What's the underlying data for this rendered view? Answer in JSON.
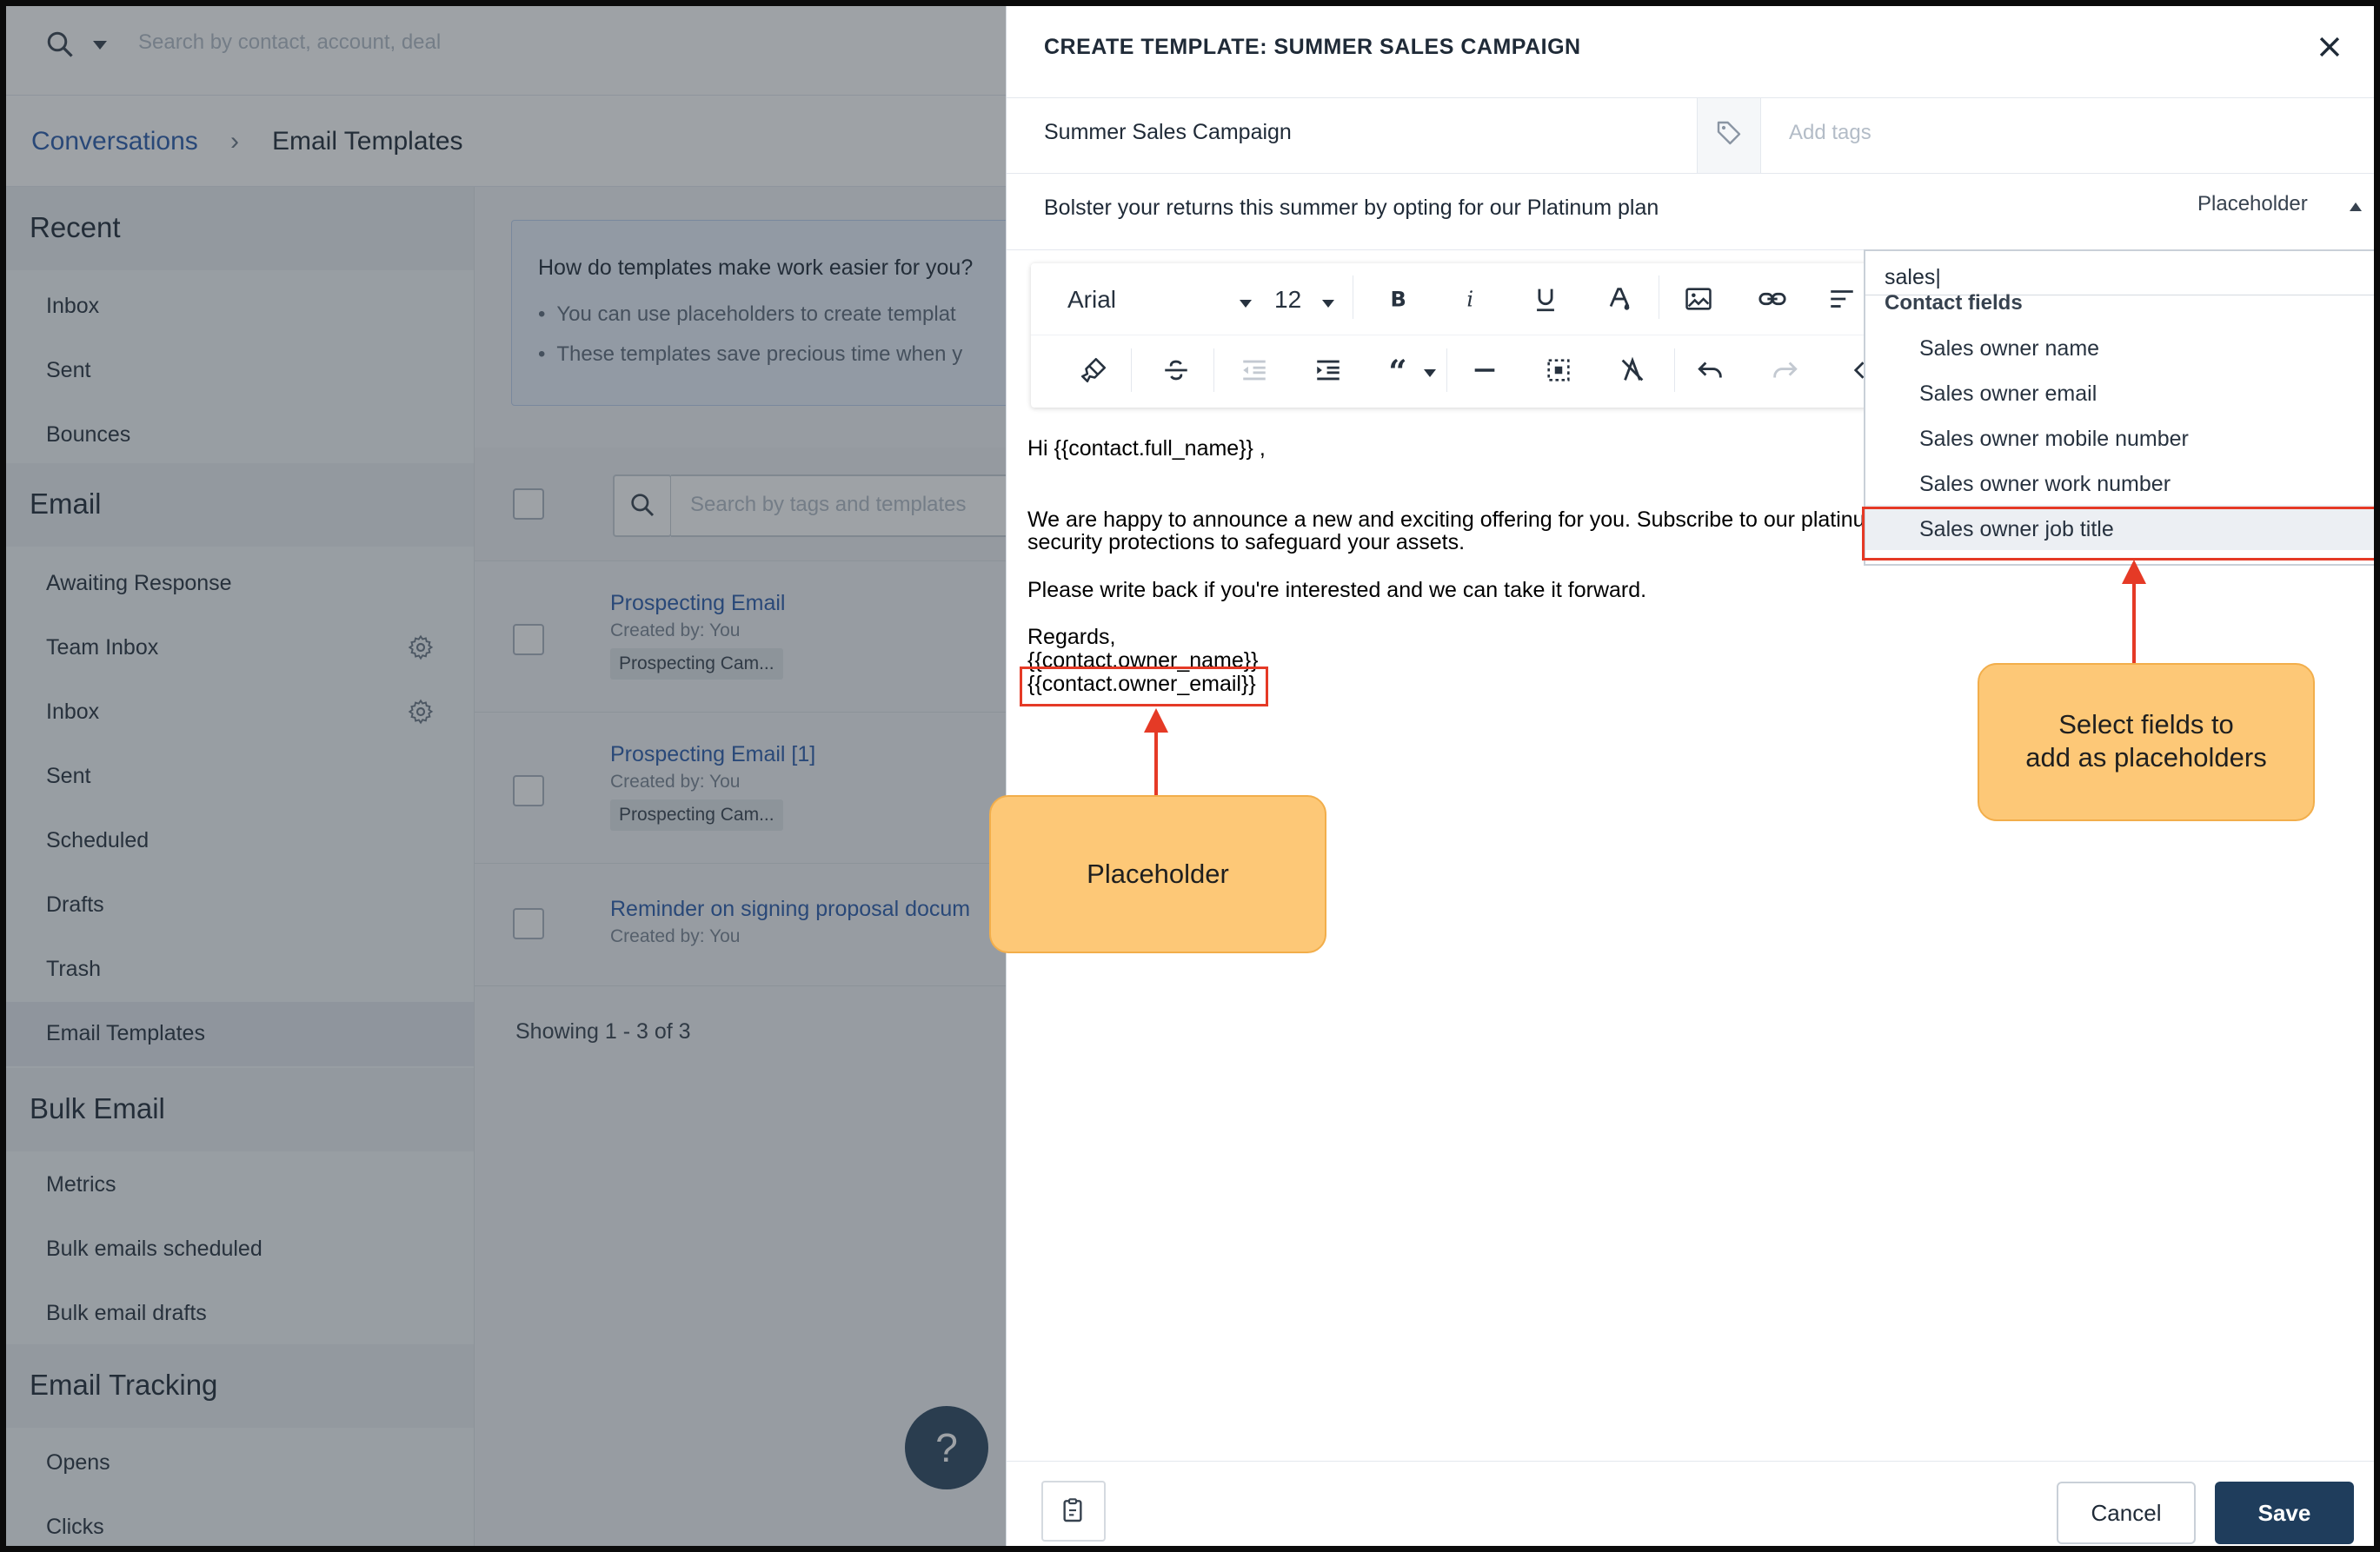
{
  "topbar": {
    "search_placeholder": "Search by contact, account, deal"
  },
  "breadcrumb": {
    "parent": "Conversations",
    "separator": "›",
    "current": "Email Templates"
  },
  "sidebar": {
    "sections": [
      {
        "title": "Recent",
        "items": [
          "Inbox",
          "Sent",
          "Bounces"
        ]
      },
      {
        "title": "Email",
        "items": [
          "Awaiting Response",
          "Team Inbox",
          "Inbox",
          "Sent",
          "Scheduled",
          "Drafts",
          "Trash",
          "Email Templates"
        ]
      },
      {
        "title": "Bulk Email",
        "items": [
          "Metrics",
          "Bulk emails scheduled",
          "Bulk email drafts"
        ]
      },
      {
        "title": "Email Tracking",
        "items": [
          "Opens",
          "Clicks"
        ]
      }
    ],
    "active_item": "Email Templates"
  },
  "info": {
    "title": "How do templates make work easier for you?",
    "bullets": [
      "You can use placeholders to create templat",
      "These templates save precious time when y"
    ]
  },
  "list": {
    "search_placeholder": "Search by tags and templates",
    "rows": [
      {
        "title": "Prospecting Email",
        "created": "Created by: You",
        "tag": "Prospecting Cam..."
      },
      {
        "title": "Prospecting Email [1]",
        "created": "Created by: You",
        "tag": "Prospecting Cam..."
      },
      {
        "title": "Reminder on signing proposal docum",
        "created": "Created by: You"
      }
    ],
    "showing": "Showing 1 - 3 of 3"
  },
  "help": {
    "label": "?"
  },
  "drawer": {
    "title": "CREATE TEMPLATE: SUMMER SALES CAMPAIGN",
    "name": "Summer Sales Campaign",
    "tags_placeholder": "Add tags",
    "subject": "Bolster your returns this summer by opting for our Platinum plan",
    "placeholder_button": "Placeholder",
    "toolbar": {
      "font": "Arial",
      "size": "12"
    },
    "body": {
      "greeting": "Hi {{contact.full_name}} ,",
      "line1": "We are happy to announce a new and exciting offering for you. Subscribe to our platinum",
      "line2": "security protections to safeguard your assets.",
      "line3": "Please write back if you're interested and we can take it forward.",
      "regards": "Regards,",
      "owner_name": "{{contact.owner_name}}",
      "owner_email": "{{contact.owner_email}}"
    },
    "dropdown": {
      "query": "sales|",
      "group": "Contact fields",
      "options": [
        "Sales owner name",
        "Sales owner email",
        "Sales owner mobile number",
        "Sales owner work number",
        "Sales owner job title"
      ],
      "selected": "Sales owner job title"
    },
    "footer": {
      "cancel": "Cancel",
      "save": "Save"
    }
  },
  "annotations": {
    "placeholder_callout": "Placeholder",
    "fields_callout": [
      "Select fields to",
      "add as placeholders"
    ]
  },
  "colors": {
    "link": "#2a5cab",
    "primary": "#1f3d5c",
    "highlight": "#e53a26",
    "callout": "#fdc877"
  }
}
